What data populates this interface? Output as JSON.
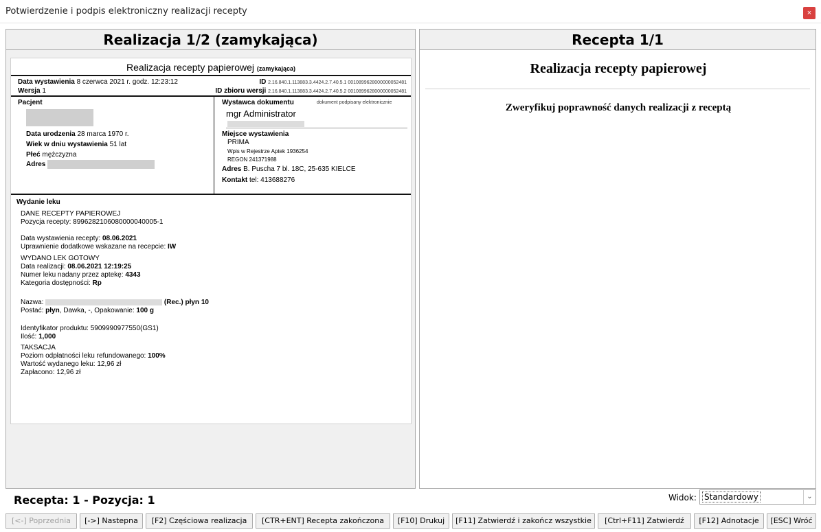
{
  "window": {
    "title": "Potwierdzenie i podpis elektroniczny realizacji recepty",
    "close": "×"
  },
  "left_panel": {
    "header": "Realizacja 1/2 (zamykająca)",
    "doc_title": "Realizacja recepty papierowej",
    "doc_title_suffix": "(zamykająca)",
    "date_label": "Data wystawienia",
    "date_value": "8 czerwca 2021 r. godz. 12:23:12",
    "id_label": "ID",
    "id_value": "2.16.840.1.113883.3.4424.2.7.40.5.1 0010899628000000052481",
    "version_label": "Wersja",
    "version_value": "1",
    "id_set_label": "ID zbioru wersji",
    "id_set_value": "2.16.840.1.113883.3.4424.2.7.40.5.2 0010899628000000052481",
    "patient": {
      "heading": "Pacjent",
      "birth_label": "Data urodzenia",
      "birth_value": "28 marca 1970 r.",
      "age_label": "Wiek w dniu wystawienia",
      "age_value": "51 lat",
      "sex_label": "Płeć",
      "sex_value": "mężczyzna",
      "address_label": "Adres"
    },
    "issuer": {
      "heading": "Wystawca dokumentu",
      "signed_note": "dokument podpisany elektronicznie",
      "name": "mgr Administrator",
      "place_heading": "Miejsce wystawienia",
      "place_name": "PRIMA",
      "registry": "Wpis w Rejestrze Aptek 1936254",
      "regon": "REGON 241371988",
      "address_label": "Adres",
      "address_value": "B. Puscha 7 bl. 18C, 25-635 KIELCE",
      "contact_label": "Kontakt",
      "contact_value": "tel: 413688276"
    },
    "issue": {
      "heading": "Wydanie leku",
      "paper_data": "DANE RECEPTY PAPIEROWEJ",
      "position_label": "Pozycja recepty:",
      "position_value": "8996282106080000040005-1",
      "rx_date_label": "Data wystawienia recepty:",
      "rx_date_value": "08.06.2021",
      "entitlement_label": "Uprawnienie dodatkowe wskazane na recepcie:",
      "entitlement_value": "IW",
      "dispensed": "WYDANO LEK GOTOWY",
      "realization_date_label": "Data realizacji:",
      "realization_date_value": "08.06.2021 12:19:25",
      "drug_number_label": "Numer leku nadany przez aptekę:",
      "drug_number_value": "4343",
      "category_label": "Kategoria dostępności:",
      "category_value": "Rp",
      "name_label": "Nazwa:",
      "name_suffix": "(Rec.) płyn 10",
      "form_label": "Postać:",
      "form_value": "płyn",
      "dose_text": ", Dawka, -, Opakowanie:",
      "package_value": "100 g",
      "product_id_label": "Identyfikator produktu:",
      "product_id_value": "5909990977550(GS1)",
      "qty_label": "Ilość:",
      "qty_value": "1,000",
      "taxation": "TAKSACJA",
      "payment_level_label": "Poziom odpłatności leku refundowanego:",
      "payment_level_value": "100%",
      "value_label": "Wartość wydanego leku:",
      "value_value": "12,96 zł",
      "paid_label": "Zapłacono:",
      "paid_value": "12,96 zł"
    }
  },
  "right_panel": {
    "header": "Recepta 1/1",
    "doc_heading": "Realizacja recepty papierowej",
    "verify_text": "Zweryfikuj poprawność danych realizacji z receptą"
  },
  "status": {
    "label": "Recepta: 1 - Pozycja: 1"
  },
  "view": {
    "label": "Widok:",
    "value": "Standardowy"
  },
  "toolbar": {
    "prev": "[<-] Poprzednia",
    "next": "[->] Nastepna",
    "partial": "[F2] Częściowa realizacja",
    "complete": "[CTR+ENT] Recepta zakończona",
    "print": "[F10] Drukuj",
    "approve_all": "[F11] Zatwierdź i zakończ wszystkie",
    "approve": "[Ctrl+F11] Zatwierdź",
    "annotations": "[F12] Adnotacje",
    "back": "[ESC] Wróć"
  }
}
